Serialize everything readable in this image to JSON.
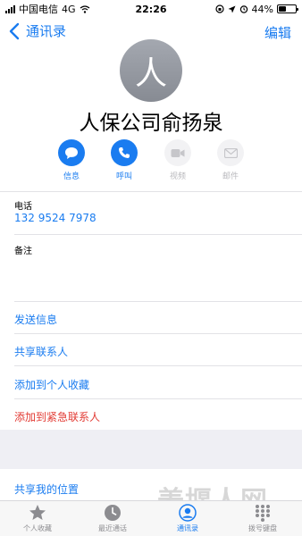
{
  "status_bar": {
    "carrier": "中国电信",
    "network": "4G",
    "time": "22:26",
    "battery": "44%",
    "battery_level": 0.44
  },
  "nav": {
    "back_label": "通讯录",
    "edit_label": "编辑"
  },
  "contact": {
    "avatar_initial": "人",
    "name": "人保公司俞扬泉"
  },
  "actions": [
    {
      "label": "信息",
      "icon": "message-icon",
      "enabled": true
    },
    {
      "label": "呼叫",
      "icon": "phone-icon",
      "enabled": true
    },
    {
      "label": "视频",
      "icon": "video-icon",
      "enabled": false
    },
    {
      "label": "邮件",
      "icon": "mail-icon",
      "enabled": false
    }
  ],
  "fields": {
    "phone_label": "电话",
    "phone_value": "132 9524 7978",
    "notes_label": "备注"
  },
  "menu": {
    "send_message": "发送信息",
    "share_contact": "共享联系人",
    "add_favorites": "添加到个人收藏",
    "add_emergency": "添加到紧急联系人",
    "share_location": "共享我的位置"
  },
  "tab_bar": [
    {
      "label": "个人收藏",
      "icon": "star-icon",
      "active": false
    },
    {
      "label": "最近通话",
      "icon": "clock-icon",
      "active": false
    },
    {
      "label": "通讯录",
      "icon": "contacts-icon",
      "active": true
    },
    {
      "label": "拨号键盘",
      "icon": "keypad-icon",
      "active": false
    }
  ],
  "watermark": "姜堰人网",
  "colors": {
    "accent": "#1a7cf0",
    "danger": "#e23b34"
  }
}
